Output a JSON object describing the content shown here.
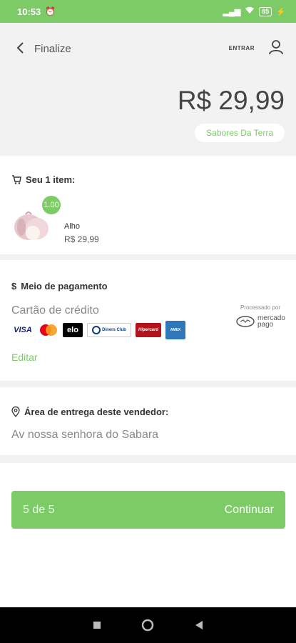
{
  "status": {
    "time": "10:53",
    "battery": "85"
  },
  "header": {
    "title": "Finalize",
    "login_label": "ENTRAR",
    "total_price": "R$ 29,99",
    "seller": "Sabores Da Terra"
  },
  "items_section": {
    "heading": "Seu 1 item:",
    "items": [
      {
        "quantity": "1.00",
        "name": "Alho",
        "price": "R$ 29,99"
      }
    ]
  },
  "payment": {
    "heading": "Meio de pagamento",
    "method": "Cartão de crédito",
    "card_brands": [
      "VISA",
      "Mastercard",
      "elo",
      "Diners Club International",
      "Hipercard",
      "American Express"
    ],
    "processed_by": "Processado por",
    "processor": "mercado pago",
    "edit_label": "Editar"
  },
  "delivery": {
    "heading": "Área de entrega deste vendedor:",
    "address": "Av nossa senhora do Sabara"
  },
  "footer": {
    "step": "5 de 5",
    "continue_label": "Continuar"
  },
  "colors": {
    "accent": "#7ccb67"
  }
}
